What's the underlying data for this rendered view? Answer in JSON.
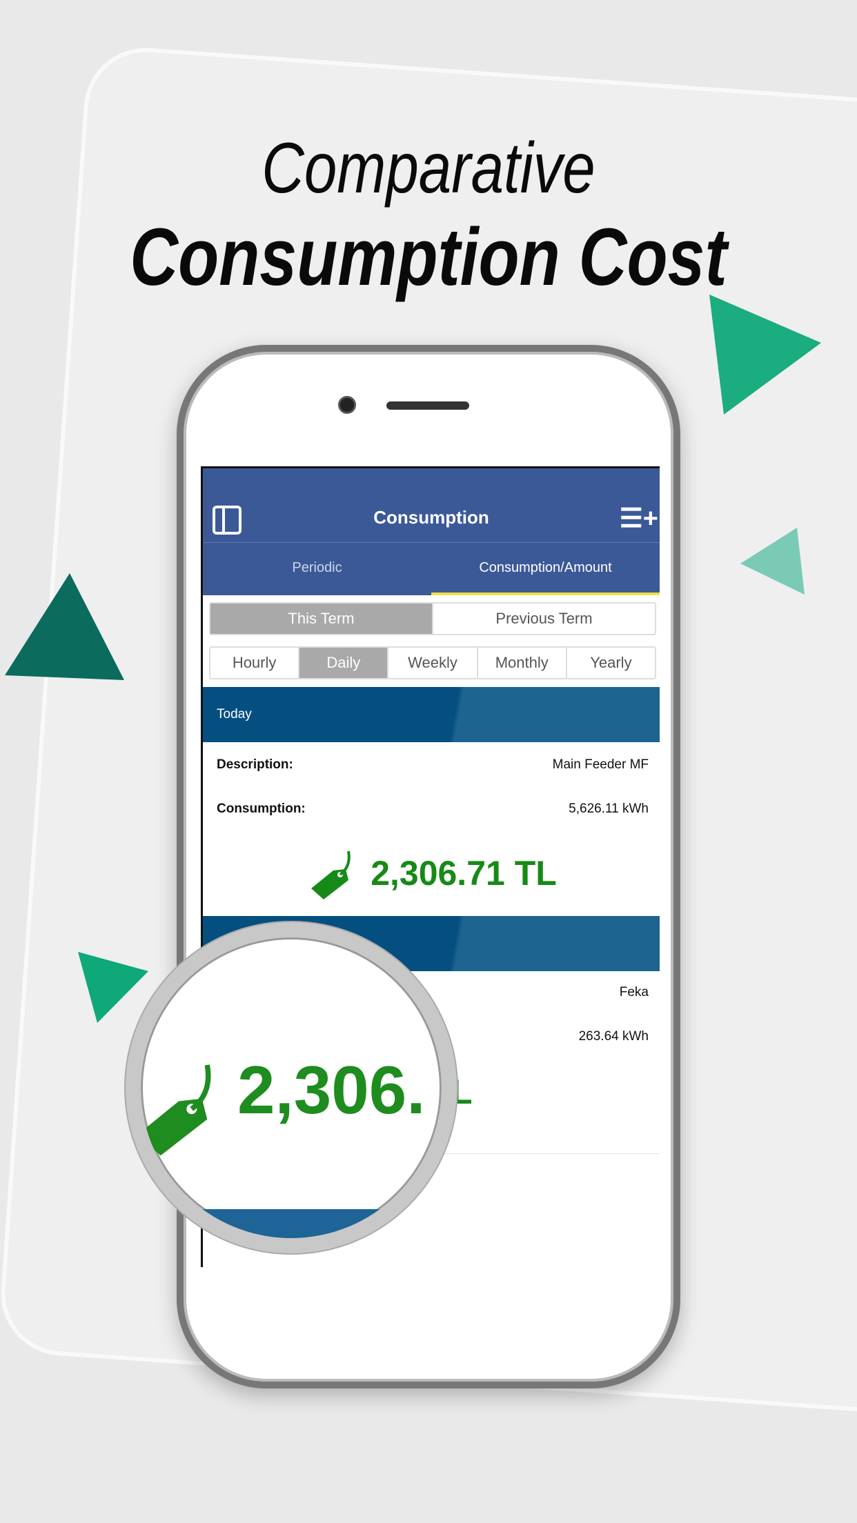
{
  "headline": {
    "line1": "Comparative",
    "line2": "Consumption Cost"
  },
  "app": {
    "title": "Consumption",
    "icons": {
      "left": "sidebar-toggle-icon",
      "right": "add-list-icon"
    },
    "tabs": [
      {
        "label": "Periodic",
        "active": false
      },
      {
        "label": "Consumption/Amount",
        "active": true
      }
    ],
    "term_segment": [
      {
        "label": "This Term",
        "selected": true
      },
      {
        "label": "Previous Term",
        "selected": false
      }
    ],
    "period_segment": [
      {
        "label": "Hourly",
        "selected": false
      },
      {
        "label": "Daily",
        "selected": true
      },
      {
        "label": "Weekly",
        "selected": false
      },
      {
        "label": "Monthly",
        "selected": false
      },
      {
        "label": "Yearly",
        "selected": false
      }
    ],
    "cards": [
      {
        "header": "Today",
        "description_label": "Description:",
        "description": "Main Feeder MF",
        "consumption_label": "Consumption:",
        "consumption": "5,626.11 kWh",
        "price": "2,306.71 TL"
      },
      {
        "description": "Feka",
        "consumption": "263.64 kWh",
        "price_visible": "09 TL"
      }
    ]
  },
  "magnifier": {
    "text": "2,306."
  },
  "colors": {
    "nav": "#3c5997",
    "accent": "#f2e04a",
    "card_header": "#054f80",
    "price": "#168a16",
    "triangle_green": "#0fa878",
    "triangle_dark": "#0b6b5c"
  }
}
